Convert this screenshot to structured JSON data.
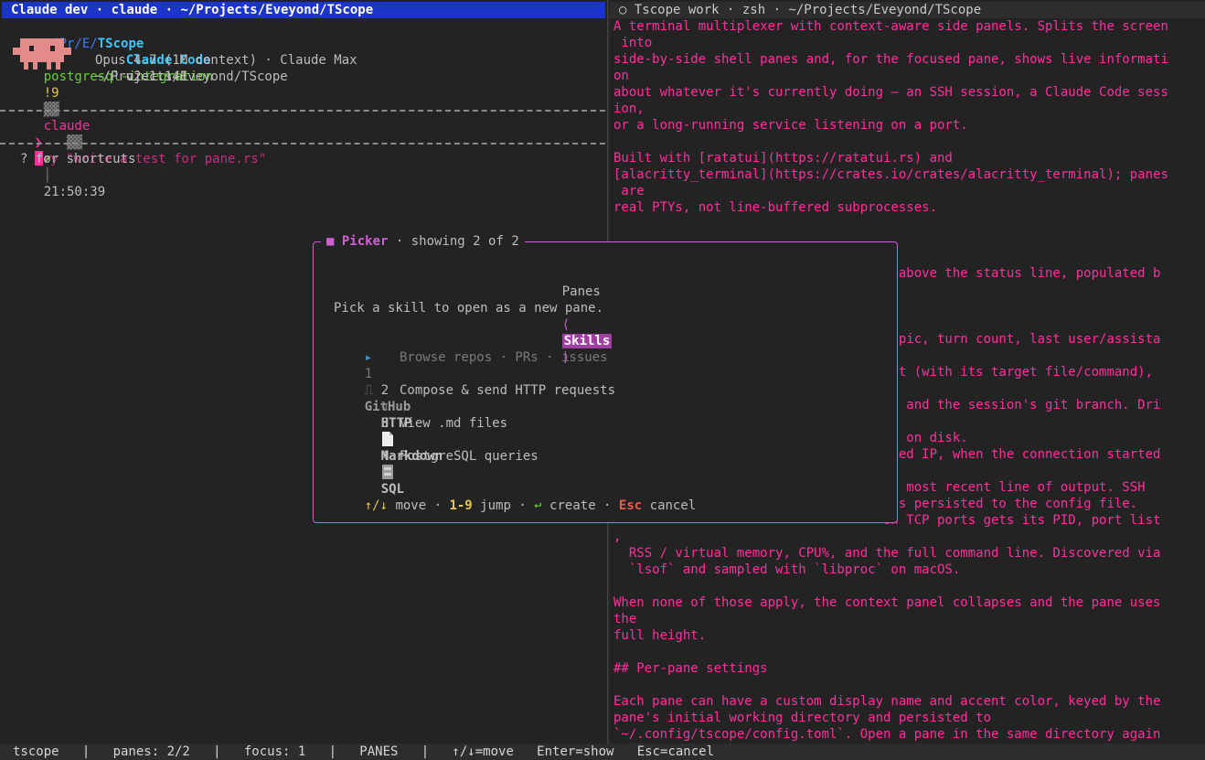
{
  "left_pane": {
    "title": "Claude dev · claude · ~/Projects/Eveyond/TScope",
    "prompt_line": {
      "path_prefix": "~/Pr/E/",
      "path_dir": "TScope",
      "separator": "│",
      "branch": "postgresql-integration",
      "changes": "!9",
      "session": "claude",
      "check": "✔",
      "clock": "21:50:39"
    },
    "banner": {
      "app_name": "Claude Code",
      "version": "v2.1.141",
      "model": "Opus 4.7 (1M context) · Claude Max",
      "cwd": "~/Projects/Eveyond/TScope"
    },
    "input": {
      "caret": "❯",
      "placeholder_first": "T",
      "placeholder_rest": "ry \"write a test for pane.rs\""
    },
    "hint": "? for shortcuts"
  },
  "right_pane": {
    "title": "○ Tscope work · zsh · ~/Projects/Eveyond/TScope",
    "lines": [
      "A terminal multiplexer with context-aware side panels. Splits the screen",
      " into",
      "side-by-side shell panes and, for the focused pane, shows live informati",
      "on",
      "about whatever it's currently doing — an SSH session, a Claude Code sess",
      "ion,",
      "or a long-running service listening on a port.",
      "",
      "Built with [ratatui](https://ratatui.rs) and",
      "[alacritty_terminal](https://crates.io/crates/alacritty_terminal); panes",
      " are",
      "real PTYs, not line-buffered subprocesses.",
      "",
      "",
      "",
      "                                  el above the status line, populated b",
      "",
      "",
      "",
      "                                   topic, turn count, last user/assista",
      "",
      "                                  ight (with its target file/command),",
      "",
      "                                  ls, and the session's git branch. Dri",
      "",
      "                                  ipt on disk.",
      "                                  olved IP, when the connection started",
      "",
      "                                  the most recent line of output. SSH",
      "                                  lias persisted to the config file.",
      "                                   on TCP ports gets its PID, port list",
      ",",
      "  RSS / virtual memory, CPU%, and the full command line. Discovered via",
      "  `lsof` and sampled with `libproc` on macOS.",
      "",
      "When none of those apply, the context panel collapses and the pane uses",
      "the",
      "full height.",
      "",
      "## Per-pane settings",
      "",
      "Each pane can have a custom display name and accent color, keyed by the",
      "pane's initial working directory and persisted to",
      "`~/.config/tscope/config.toml`. Open a pane in the same directory again"
    ]
  },
  "picker": {
    "marker": "■",
    "name": "Picker",
    "subtitle": " · showing 2 of 2 ",
    "tabs": {
      "panes": "Panes",
      "left_bracket": "⟨",
      "skills": "Skills",
      "right_bracket": "⟩"
    },
    "instruction": "Pick a skill to open as a new pane.",
    "items": [
      {
        "pointer": "▸",
        "num": "1",
        "icon": "⎍",
        "name": "GitHub",
        "desc": "Browse repos · PRs · issues"
      },
      {
        "pointer": "",
        "num": "2",
        "icon": "↯",
        "name": "HTTP",
        "desc": "Compose & send HTTP requests"
      },
      {
        "pointer": "",
        "num": "3",
        "icon": "📄",
        "name": "Markdown",
        "desc": "View .md files"
      },
      {
        "pointer": "",
        "num": "4",
        "icon": "🗄",
        "name": "SQL",
        "desc": "PostgreSQL queries"
      }
    ],
    "footer": {
      "move_keys": "↑/↓",
      "move_label": " move · ",
      "jump_keys": "1-9",
      "jump_label": " jump · ",
      "create_key": "↩",
      "create_label": " create · ",
      "cancel_key": "Esc",
      "cancel_label": " cancel"
    }
  },
  "status_bar": {
    "text": "tscope   |   panes: 2/2   |   focus: 1   |   PANES   |   ↑/↓=move   Enter=show   Esc=cancel"
  },
  "colors": {
    "accent_pink": "#ff2f9e",
    "picker_border": "#d15fd1",
    "title_bar_focused": "#1a35c8"
  }
}
